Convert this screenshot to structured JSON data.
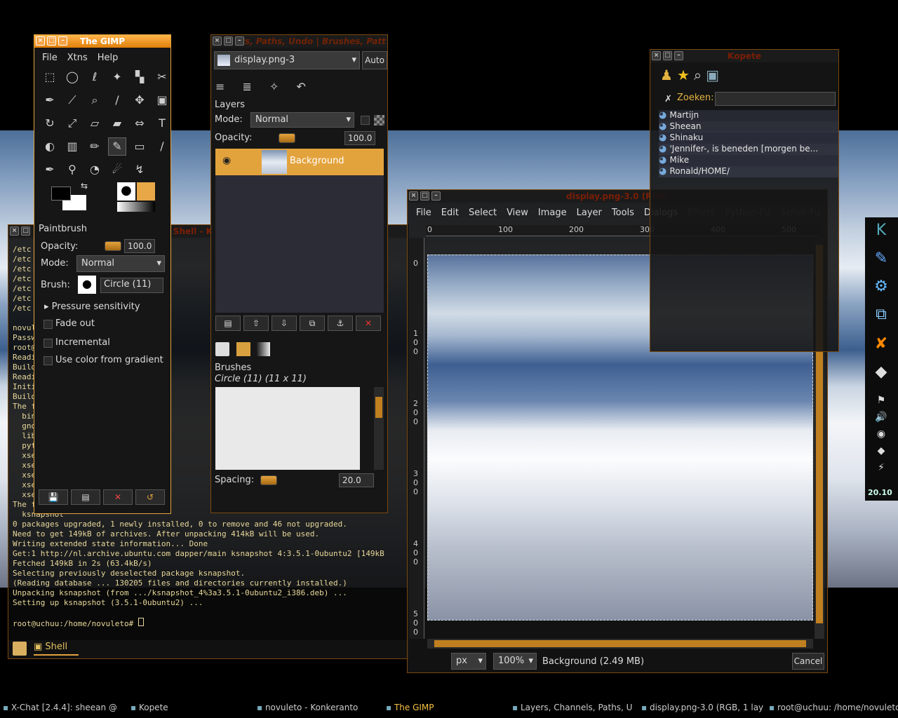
{
  "gimp_toolbox": {
    "title": "The GIMP",
    "menu": [
      "File",
      "Xtns",
      "Help"
    ],
    "tool_name": "Paintbrush",
    "opacity_label": "Opacity:",
    "opacity_value": "100.0",
    "mode_label": "Mode:",
    "mode_value": "Normal",
    "brush_label": "Brush:",
    "brush_value": "Circle (11)",
    "pressure": "Pressure sensitivity",
    "fade": "Fade out",
    "incremental": "Incremental",
    "gradient": "Use color from gradient"
  },
  "layers_dialog": {
    "title": "rs, Paths, Undo | Brushes, Patt",
    "image_select": "display.png-3",
    "auto_label": "Auto",
    "section": "Layers",
    "mode_label": "Mode:",
    "mode_value": "Normal",
    "opacity_label": "Opacity:",
    "opacity_value": "100.0",
    "layer_name": "Background",
    "brushes_label": "Brushes",
    "brush_current": "Circle (11) (11 x 11)",
    "spacing_label": "Spacing:",
    "spacing_value": "20.0"
  },
  "kopete": {
    "title": "Kopete",
    "search_label": "Zoeken:",
    "contacts": [
      "Martijn",
      "Sheean",
      "Shinaku",
      "'Jennifer-,  is beneden [morgen be...",
      "Mike",
      "Ronald/HOME/"
    ]
  },
  "image_window": {
    "title": "display.png-3.0 (RGB,",
    "menu": [
      "File",
      "Edit",
      "Select",
      "View",
      "Image",
      "Layer",
      "Tools",
      "Dialogs",
      "Filters",
      "Python-Fu",
      "Script-Fu"
    ],
    "ruler_top": [
      "0",
      "100",
      "200",
      "300",
      "400",
      "500"
    ],
    "ruler_left": [
      "0",
      "1 0 0",
      "2 0 0",
      "3 0 0",
      "4 0 0",
      "5 0 0"
    ],
    "unit": "px",
    "zoom": "100%",
    "status": "Background (2.49 MB)",
    "cancel": "Cancel"
  },
  "terminal": {
    "title": "Shell - Konsole",
    "tab": "Shell",
    "left_lines": [
      "/etc",
      "/etc",
      "/etc",
      "/etc",
      "/etc",
      "/etc",
      "/etc",
      "",
      "novule",
      "Passw",
      "root@",
      "Readi",
      "Build",
      "Readi",
      "Initi",
      "Build",
      "The f",
      "  bin",
      "  gno",
      "  lib",
      "  pyt",
      "  xse",
      "  xse",
      "  xse",
      "  xse",
      "  xse",
      "The f",
      "  ksnapshot"
    ],
    "lines": [
      "0 packages upgraded, 1 newly installed, 0 to remove and 46 not upgraded.",
      "Need to get 149kB of archives. After unpacking 414kB will be used.",
      "Writing extended state information... Done",
      "Get:1 http://nl.archive.ubuntu.com dapper/main ksnapshot 4:3.5.1-0ubuntu2 [149kB",
      "Fetched 149kB in 2s (63.4kB/s)",
      "Selecting previously deselected package ksnapshot.",
      "(Reading database ... 130205 files and directories currently installed.)",
      "Unpacking ksnapshot (from .../ksnapshot_4%3a3.5.1-0ubuntu2_i386.deb) ...",
      "Setting up ksnapshot (3.5.1-0ubuntu2) ...",
      "",
      "root@uchuu:/home/novuleto# "
    ]
  },
  "taskbar": {
    "items": [
      "X-Chat [2.4.4]: sheean @",
      "Kopete",
      "novuleto - Konkeranto",
      "The GIMP",
      "Layers, Channels, Paths, U",
      "display.png-3.0 (RGB, 1 lay",
      "root@uchuu: /home/novuleto"
    ],
    "clock": "20.10"
  },
  "colors": {
    "accent": "#e3a33c",
    "active_title": "#f0921e"
  }
}
